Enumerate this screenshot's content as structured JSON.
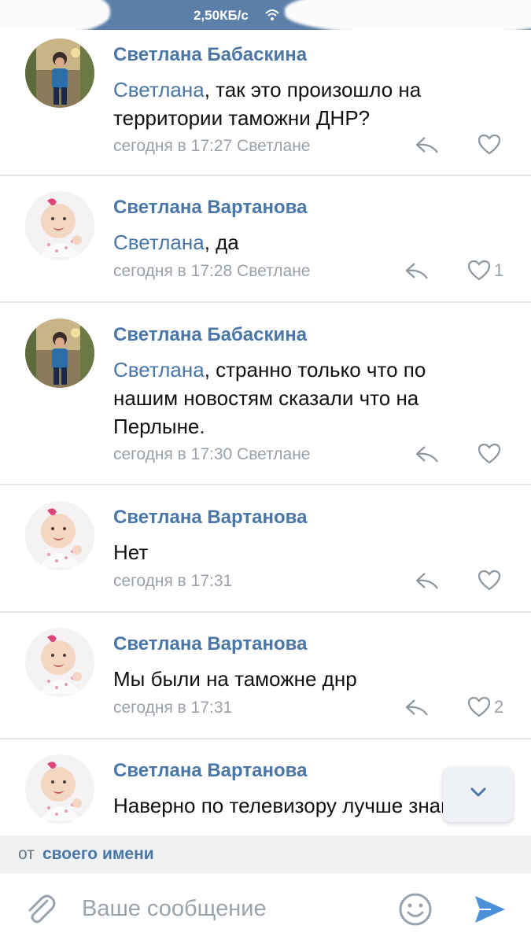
{
  "status_bar": {
    "speed": "2,50КБ/с",
    "icons": [
      "wifi-icon"
    ]
  },
  "comments": [
    {
      "author": "Светлана Бабаскина",
      "mention": "Светлана",
      "text": ", так это произошло на территории таможни ДНР?",
      "time": "сегодня в 17:27",
      "reply_to": "Светлане",
      "likes": "",
      "avatar": "photo-woman"
    },
    {
      "author": "Светлана Вартанова",
      "mention": "Светлана",
      "text": ", да",
      "time": "сегодня в 17:28",
      "reply_to": "Светлане",
      "likes": "1",
      "avatar": "photo-baby"
    },
    {
      "author": "Светлана Бабаскина",
      "mention": "Светлана",
      "text": ", странно только что по нашим новостям сказали что на Перлыне.",
      "time": "сегодня в 17:30",
      "reply_to": "Светлане",
      "likes": "",
      "avatar": "photo-woman"
    },
    {
      "author": "Светлана Вартанова",
      "mention": "",
      "text": "Нет",
      "time": "сегодня в 17:31",
      "reply_to": "",
      "likes": "",
      "avatar": "photo-baby"
    },
    {
      "author": "Светлана Вартанова",
      "mention": "",
      "text": "Мы были на таможне днр",
      "time": "сегодня в 17:31",
      "reply_to": "",
      "likes": "2",
      "avatar": "photo-baby"
    },
    {
      "author": "Светлана Вартанова",
      "mention": "",
      "text": "Наверно по телевизору лучше знают",
      "time": "",
      "reply_to": "",
      "likes": "",
      "avatar": "photo-baby"
    }
  ],
  "scroll_down_icon": "chevron-down-icon",
  "from_bar": {
    "prefix": "от",
    "name": "своего имени"
  },
  "compose": {
    "placeholder": "Ваше сообщение",
    "icons": [
      "paperclip-icon",
      "emoji-icon",
      "send-icon"
    ]
  },
  "colors": {
    "link": "#4a76a8",
    "meta": "#9aa1a9",
    "status_bar": "#5b7fa8",
    "from_bar": "#eff1f3",
    "send": "#4a90d9"
  }
}
